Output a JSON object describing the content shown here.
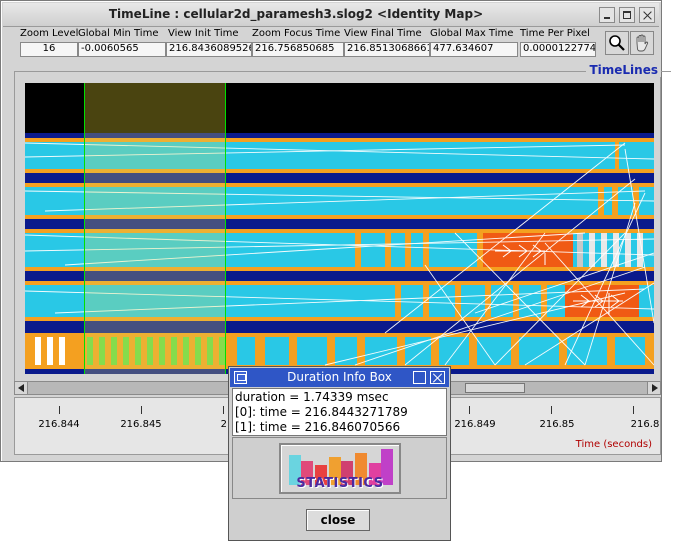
{
  "window": {
    "title": "TimeLine : cellular2d_paramesh3.slog2  <Identity Map>"
  },
  "fields": [
    {
      "label": "Zoom Level",
      "value": "16"
    },
    {
      "label": "Global Min Time",
      "value": "-0.0060565"
    },
    {
      "label": "View  Init Time",
      "value": "216.8436089526"
    },
    {
      "label": "Zoom Focus Time",
      "value": "216.756850685"
    },
    {
      "label": "View Final Time",
      "value": "216.8513068661"
    },
    {
      "label": "Global Max Time",
      "value": "477.634607"
    },
    {
      "label": "Time Per Pixel",
      "value": "0.0000122774"
    }
  ],
  "toolbar": {
    "zoom_icon": "magnifier-icon",
    "hand_icon": "hand-icon"
  },
  "panel": {
    "title": "TimeLines"
  },
  "ruler": {
    "ticks": [
      "216.844",
      "216.845",
      "21",
      "216.849",
      "216.85",
      "216.8"
    ],
    "axis_label": "Time (seconds)"
  },
  "dialog": {
    "title": "Duration Info Box",
    "lines": [
      "duration = 1.74339 msec",
      "[0]: time = 216.8443271789",
      "[1]: time = 216.846070566"
    ],
    "statistics_label": "STATISTICS",
    "close_label": "close"
  },
  "colors": {
    "cyan": "#29c8e6",
    "orange": "#f4a020",
    "red_orange": "#f05a14",
    "navy": "#0a1a8c",
    "olive_selection": "#4a4410",
    "selection_border": "#00e000",
    "dialog_title": "#2f56c6",
    "panel_title": "#1a2bb0"
  }
}
